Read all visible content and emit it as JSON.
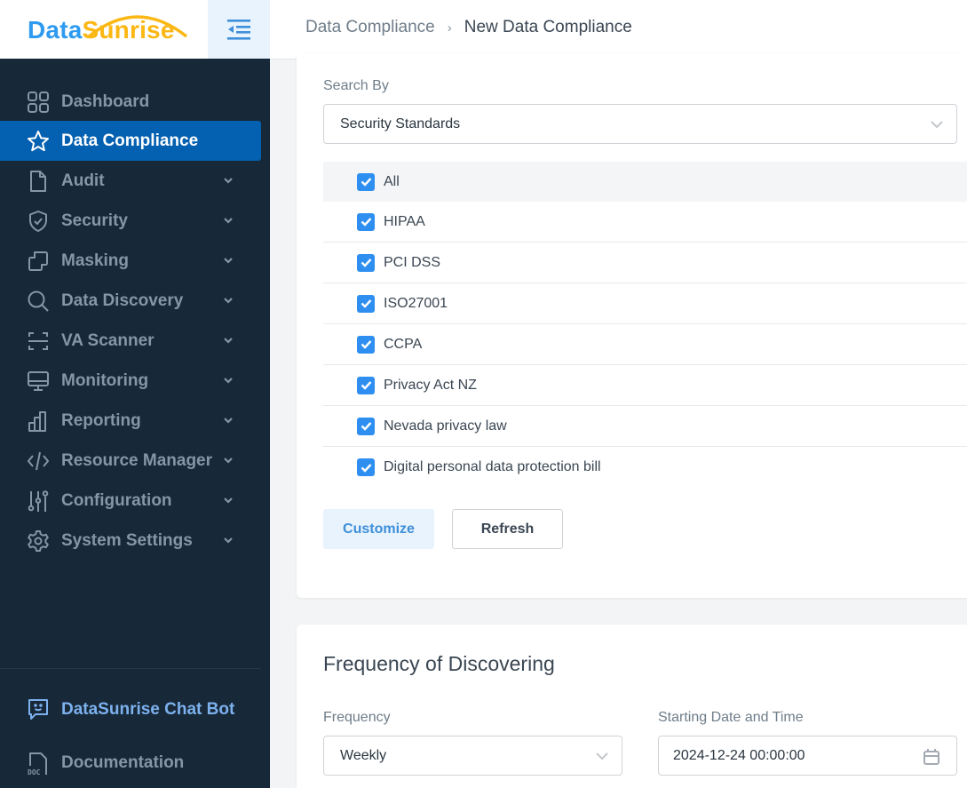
{
  "logo": {
    "part1": "Data",
    "part2": "Sunrise",
    "colors": {
      "data": "#2e9bf0",
      "sunrise": "#fbb714"
    }
  },
  "header": {
    "collapse_icon": "menu-collapse-icon",
    "breadcrumb": {
      "parent": "Data Compliance",
      "separator": "›",
      "current": "New Data Compliance"
    }
  },
  "sidebar": {
    "active_color": "#0460b0",
    "items": [
      {
        "label": "Dashboard",
        "icon": "dashboard-grid-icon",
        "expandable": false,
        "active": false
      },
      {
        "label": "Data Compliance",
        "icon": "star-icon",
        "expandable": false,
        "active": true
      },
      {
        "label": "Audit",
        "icon": "document-icon",
        "expandable": true,
        "active": false
      },
      {
        "label": "Security",
        "icon": "shield-check-icon",
        "expandable": true,
        "active": false
      },
      {
        "label": "Masking",
        "icon": "masking-icon",
        "expandable": true,
        "active": false
      },
      {
        "label": "Data Discovery",
        "icon": "search-icon",
        "expandable": true,
        "active": false
      },
      {
        "label": "VA Scanner",
        "icon": "scanner-icon",
        "expandable": true,
        "active": false
      },
      {
        "label": "Monitoring",
        "icon": "monitor-icon",
        "expandable": true,
        "active": false
      },
      {
        "label": "Reporting",
        "icon": "bar-chart-icon",
        "expandable": true,
        "active": false
      },
      {
        "label": "Resource Manager",
        "icon": "code-icon",
        "expandable": true,
        "active": false
      },
      {
        "label": "Configuration",
        "icon": "sliders-icon",
        "expandable": true,
        "active": false
      },
      {
        "label": "System Settings",
        "icon": "gear-icon",
        "expandable": true,
        "active": false
      }
    ],
    "bottom": {
      "chatbot": {
        "label": "DataSunrise Chat Bot",
        "icon": "chat-bot-icon"
      },
      "documentation": {
        "label": "Documentation",
        "icon": "doc-icon"
      }
    }
  },
  "search_section": {
    "search_by_label": "Search By",
    "search_by_value": "Security Standards",
    "standards": [
      {
        "label": "All",
        "checked": true
      },
      {
        "label": "HIPAA",
        "checked": true
      },
      {
        "label": "PCI DSS",
        "checked": true
      },
      {
        "label": "ISO27001",
        "checked": true
      },
      {
        "label": "CCPA",
        "checked": true
      },
      {
        "label": "Privacy Act NZ",
        "checked": true
      },
      {
        "label": "Nevada privacy law",
        "checked": true
      },
      {
        "label": "Digital personal data protection bill",
        "checked": true
      }
    ],
    "customize_label": "Customize",
    "refresh_label": "Refresh"
  },
  "frequency_section": {
    "title": "Frequency of Discovering",
    "frequency_label": "Frequency",
    "frequency_value": "Weekly",
    "start_label": "Starting Date and Time",
    "start_value": "2024-12-24 00:00:00"
  }
}
